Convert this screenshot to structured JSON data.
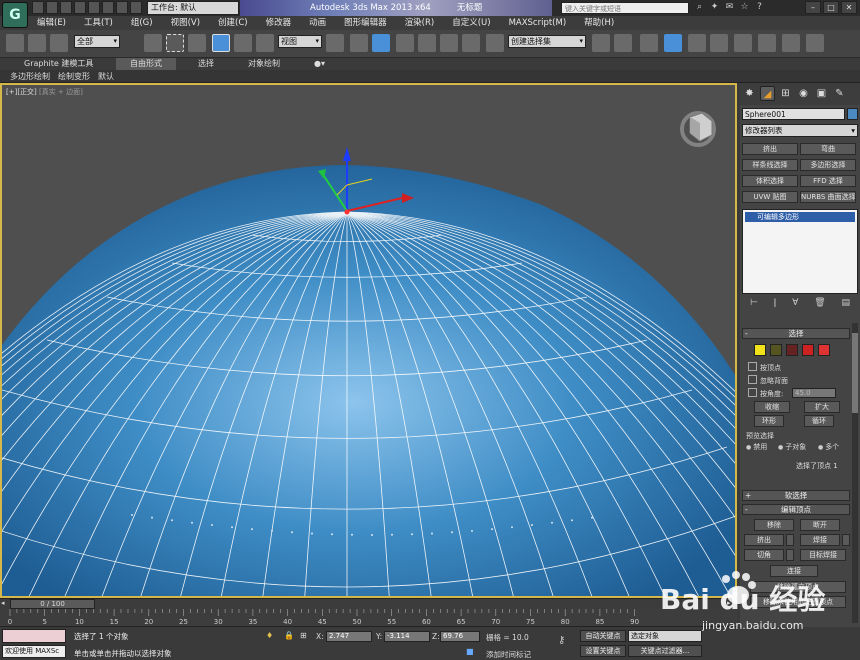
{
  "titlebar": {
    "workspace_label": "工作台: 默认",
    "app_title": "Autodesk 3ds Max  2013 x64",
    "doc_title": "无标题",
    "search_placeholder": "键入关键字或短语"
  },
  "menu": [
    "编辑(E)",
    "工具(T)",
    "组(G)",
    "视图(V)",
    "创建(C)",
    "修改器",
    "动画",
    "图形编辑器",
    "渲染(R)",
    "自定义(U)",
    "MAXScript(M)",
    "帮助(H)"
  ],
  "toolbar": {
    "filter_dropdown": "全部",
    "ref_coord_dropdown": "视图",
    "named_selection": "创建选择集"
  },
  "ribbon": {
    "tabs": [
      "Graphite 建模工具",
      "自由形式",
      "选择",
      "对象绘制"
    ],
    "active_tab": "自由形式",
    "subtabs": [
      "多边形绘制",
      "绘制变形",
      "默认"
    ]
  },
  "viewport": {
    "label_main": "[+][正交]",
    "label_dim": "[真实 + 边面]"
  },
  "command_panel": {
    "object_name": "Sphere001",
    "modifier_list": "修改器列表",
    "modifier_buttons": [
      "挤出",
      "弯曲",
      "样条线选择",
      "多边形选择",
      "体积选择",
      "FFD 选择",
      "UVW 贴图",
      "NURBS 曲面选择"
    ],
    "stack_item": "可编辑多边形",
    "selection_rollout": {
      "title": "选择",
      "by_vertex": "按顶点",
      "ignore_backfacing": "忽略背面",
      "by_angle": "按角度:",
      "angle_value": "45.0",
      "shrink": "收缩",
      "grow": "扩大",
      "ring": "环形",
      "loop": "循环",
      "preview_selection": "预览选择",
      "preview_options": [
        "禁用",
        "子对象",
        "多个"
      ],
      "status": "选择了顶点 1"
    },
    "soft_selection": "软选择",
    "edit_vertices": {
      "title": "编辑顶点",
      "remove": "移除",
      "break": "断开",
      "extrude": "挤出",
      "weld": "焊接",
      "chamfer": "切角",
      "target_weld": "目标焊接",
      "connect": "连接",
      "remove_isolated": "移除孤立顶点",
      "remove_unused_map": "移除未使用的贴图顶点"
    }
  },
  "timeline": {
    "frame_display": "0 / 100",
    "ruler_ticks": [
      "0",
      "5",
      "10",
      "15",
      "20",
      "25",
      "30",
      "35",
      "40",
      "45",
      "50",
      "55",
      "60",
      "65",
      "70",
      "75",
      "80",
      "85",
      "90"
    ]
  },
  "statusbar": {
    "welcome": "欢迎使用 MAXSc",
    "selected": "选择了 1 个对象",
    "prompt": "单击或单击并拖动以选择对象",
    "x_value": "2.747",
    "y_value": "-3.114",
    "z_value": "69.76",
    "grid": "栅格 = 10.0",
    "auto_key": "自动关键点",
    "selection_filter": "选定对象",
    "set_key": "设置关键点",
    "key_filters": "关键点过滤器...",
    "add_time_tag": "添加时间标记"
  },
  "watermark": {
    "brand": "Bai du 经验",
    "url": "jingyan.baidu.com"
  },
  "colors": {
    "sphere": "#3a86c0",
    "wire": "#ffffff",
    "viewport_border": "#d6b84a",
    "stack_highlight": "#2f5ea8"
  }
}
